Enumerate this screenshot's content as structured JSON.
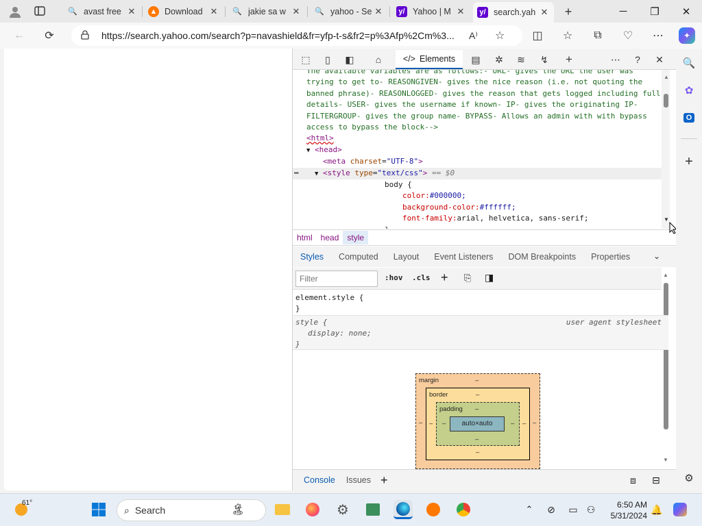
{
  "tabs": [
    {
      "title": "avast free",
      "icon": "search-icon"
    },
    {
      "title": "Download",
      "icon": "avast-icon"
    },
    {
      "title": "jakie sa w",
      "icon": "search-icon"
    },
    {
      "title": "yahoo - Se",
      "icon": "search-icon"
    },
    {
      "title": "Yahoo | M",
      "icon": "yahoo-icon"
    },
    {
      "title": "search.yah",
      "icon": "yahoo-icon",
      "active": true
    }
  ],
  "address": {
    "url": "https://search.yahoo.com/search?p=navashield&fr=yfp-t-s&fr2=p%3Afp%2Cm%3..."
  },
  "devtools": {
    "main_tab": "Elements",
    "dom_lines": {
      "l1": "The available variables are as follows:- URL- gives the URL the user was",
      "l2": "trying to get to- REASONGIVEN- gives the nice reason (i.e. not quoting the",
      "l3": "banned phrase)- REASONLOGGED- gives the reason that gets logged including full",
      "l4": "details- USER- gives the username if known- IP- gives the originating IP-",
      "l5": "FILTERGROUP- gives the group name- BYPASS- Allows an admin with with bypass",
      "l6": "access to bypass the block-->",
      "html": "<html>",
      "head": "<head>",
      "meta_tag": "<meta",
      "meta_attr": "charset",
      "meta_val": "\"UTF-8\"",
      "meta_end": ">",
      "style_tag": "<style",
      "style_attr": "type",
      "style_val": "\"text/css\"",
      "style_end": ">",
      "style_eq": "== $0",
      "body_sel": "body {",
      "color_prop": "color:",
      "color_val": "#000000;",
      "bg_prop": "background-color:",
      "bg_val": "#ffffff;",
      "font_prop": "font-family:",
      "font_val": "arial, helvetica, sans-serif;",
      "close_brace": "}"
    },
    "breadcrumbs": [
      "html",
      "head",
      "style"
    ],
    "sub_tabs": [
      "Styles",
      "Computed",
      "Layout",
      "Event Listeners",
      "DOM Breakpoints",
      "Properties"
    ],
    "filter_placeholder": "Filter",
    "hov": ":hov",
    "cls": ".cls",
    "rules": {
      "element_style": "element.style {",
      "element_close": "}",
      "style_selector": "style {",
      "ua_label": "user agent stylesheet",
      "style_decl": "display: none;",
      "style_close": "}"
    },
    "box_model": {
      "margin_label": "margin",
      "border_label": "border",
      "padding_label": "padding",
      "content": "auto×auto",
      "dash": "–"
    },
    "drawer_tabs": [
      "Console",
      "Issues"
    ]
  },
  "taskbar": {
    "weather_temp": "61°",
    "search_label": "Search",
    "time": "6:50 AM",
    "date": "5/31/2024"
  },
  "colors": {
    "accent": "#0c5bb0",
    "tag": "#881280",
    "comment": "#236e25"
  }
}
